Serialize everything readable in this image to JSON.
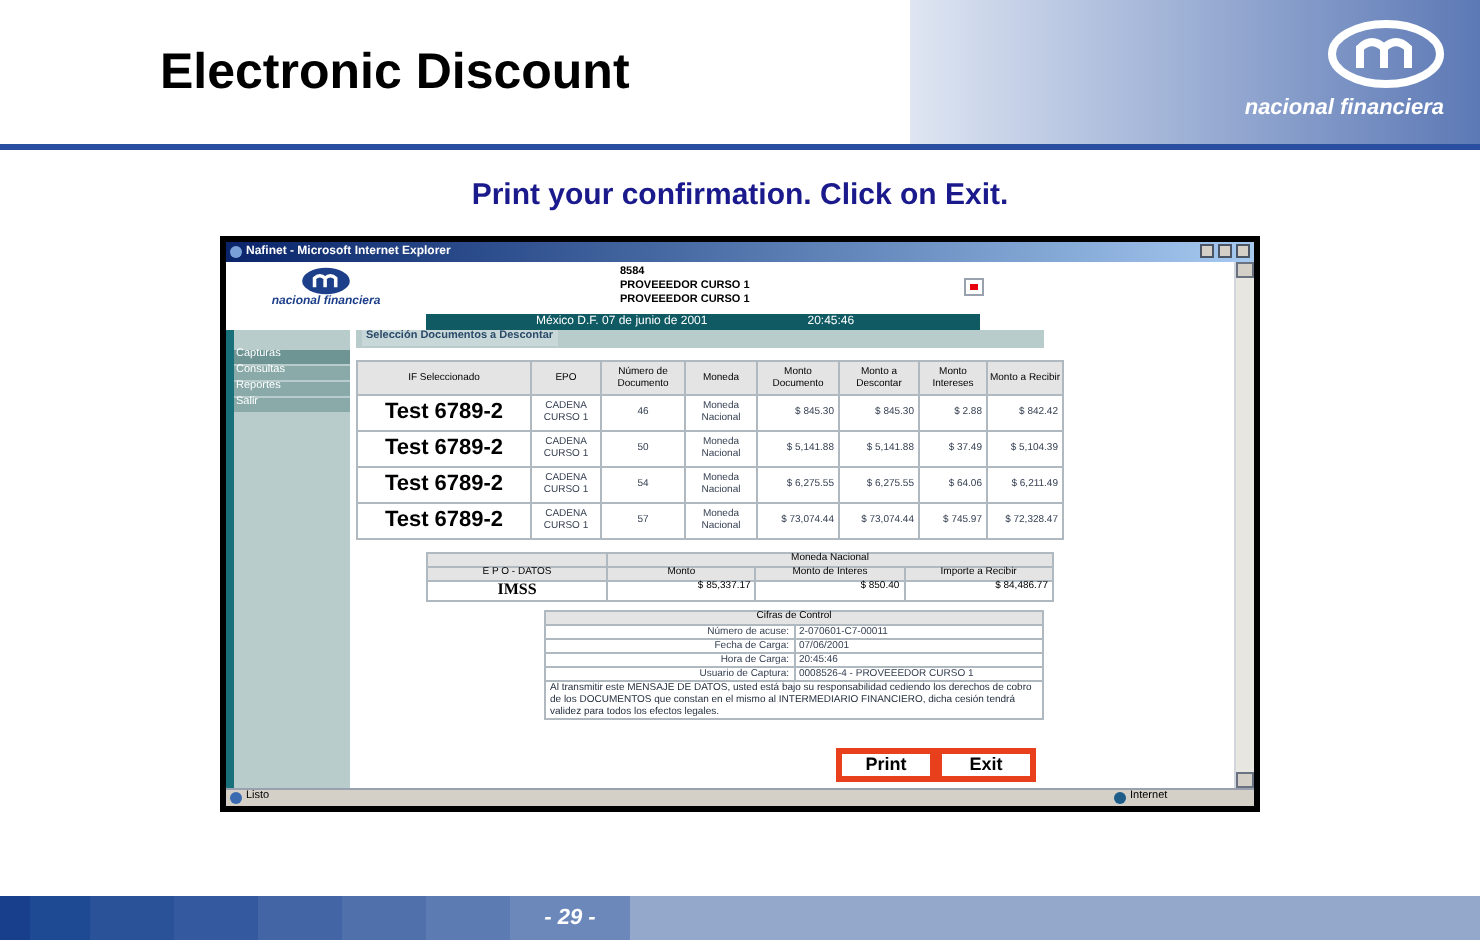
{
  "slide": {
    "title": "Electronic Discount",
    "logo_text": "nacional financiera",
    "instruction": "Print your confirmation. Click on Exit.",
    "page_number": "- 29 -"
  },
  "browser": {
    "title": "Nafinet - Microsoft Internet Explorer",
    "status": "Listo",
    "zone": "Internet"
  },
  "header": {
    "logo_text": "nacional financiera",
    "lines": [
      "8584",
      "PROVEEEDOR CURSO 1",
      "PROVEEEDOR CURSO 1"
    ],
    "date": "México D.F. 07 de junio de 2001",
    "time": "20:45:46"
  },
  "sidebar": {
    "items": [
      {
        "label": "Capturas",
        "selected": true
      },
      {
        "label": "Consultas",
        "selected": false
      },
      {
        "label": "Reportes",
        "selected": false
      },
      {
        "label": "Salir",
        "selected": false
      }
    ]
  },
  "section_title": "Selección Documentos a Descontar",
  "table": {
    "columns": [
      "IF Seleccionado",
      "EPO",
      "Número de Documento",
      "Moneda",
      "Monto Documento",
      "Monto a Descontar",
      "Monto Intereses",
      "Monto a Recibir"
    ],
    "rows": [
      [
        "Test 6789-2",
        "CADENA CURSO 1",
        "46",
        "Moneda Nacional",
        "$ 845.30",
        "$ 845.30",
        "$ 2.88",
        "$ 842.42"
      ],
      [
        "Test 6789-2",
        "CADENA CURSO 1",
        "50",
        "Moneda Nacional",
        "$ 5,141.88",
        "$ 5,141.88",
        "$ 37.49",
        "$ 5,104.39"
      ],
      [
        "Test 6789-2",
        "CADENA CURSO 1",
        "54",
        "Moneda Nacional",
        "$ 6,275.55",
        "$ 6,275.55",
        "$ 64.06",
        "$ 6,211.49"
      ],
      [
        "Test 6789-2",
        "CADENA CURSO 1",
        "57",
        "Moneda Nacional",
        "$ 73,074.44",
        "$ 73,074.44",
        "$ 745.97",
        "$ 72,328.47"
      ]
    ]
  },
  "summary": {
    "group": "Moneda Nacional",
    "columns": [
      "E P O - DATOS",
      "Monto",
      "Monto de Interes",
      "Importe a Recibir"
    ],
    "row": [
      "IMSS",
      "$ 85,337.17",
      "$ 850.40",
      "$ 84,486.77"
    ]
  },
  "control": {
    "title": "Cifras de Control",
    "rows": [
      [
        "Número de acuse:",
        "2-070601-C7-00011"
      ],
      [
        "Fecha de Carga:",
        "07/06/2001"
      ],
      [
        "Hora de Carga:",
        "20:45:46"
      ],
      [
        "Usuario de Captura:",
        "0008526-4 - PROVEEEDOR CURSO 1"
      ]
    ],
    "notice": "Al transmitir este MENSAJE DE DATOS, usted está bajo su responsabilidad cediendo los derechos de cobro de los DOCUMENTOS que constan en el mismo al INTERMEDIARIO FINANCIERO, dicha cesión tendrá validez para todos los efectos legales."
  },
  "buttons": [
    "Print",
    "Exit"
  ]
}
